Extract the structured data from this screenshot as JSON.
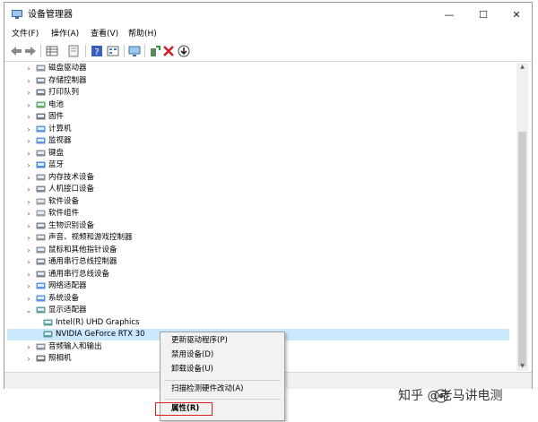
{
  "window": {
    "title": "设备管理器"
  },
  "window_controls": {
    "minimize": "—",
    "maximize": "☐",
    "close": "✕"
  },
  "menu": [
    {
      "label": "文件(F)"
    },
    {
      "label": "操作(A)"
    },
    {
      "label": "查看(V)"
    },
    {
      "label": "帮助(H)"
    }
  ],
  "toolbar": {
    "buttons": [
      {
        "icon": "back-arrow-icon"
      },
      {
        "icon": "forward-arrow-icon"
      },
      {
        "icon": "properties-grid-icon"
      },
      {
        "icon": "document-icon"
      },
      {
        "icon": "help-icon"
      },
      {
        "icon": "grid-view-icon"
      },
      {
        "icon": "monitor-scan-icon"
      },
      {
        "icon": "add-driver-icon"
      },
      {
        "icon": "remove-x-icon"
      },
      {
        "icon": "download-icon"
      }
    ]
  },
  "tree": {
    "categories": [
      {
        "label": "磁盘驱动器",
        "expander": "›",
        "icon": "disk-icon"
      },
      {
        "label": "存储控制器",
        "expander": "›",
        "icon": "storage-controller-icon"
      },
      {
        "label": "打印队列",
        "expander": "›",
        "icon": "printer-icon"
      },
      {
        "label": "电池",
        "expander": "›",
        "icon": "battery-icon"
      },
      {
        "label": "固件",
        "expander": "›",
        "icon": "firmware-icon"
      },
      {
        "label": "计算机",
        "expander": "›",
        "icon": "computer-icon"
      },
      {
        "label": "监视器",
        "expander": "›",
        "icon": "monitor-icon"
      },
      {
        "label": "键盘",
        "expander": "›",
        "icon": "keyboard-icon"
      },
      {
        "label": "蓝牙",
        "expander": "›",
        "icon": "bluetooth-icon"
      },
      {
        "label": "内存技术设备",
        "expander": "›",
        "icon": "memory-icon"
      },
      {
        "label": "人机接口设备",
        "expander": "›",
        "icon": "hid-icon"
      },
      {
        "label": "软件设备",
        "expander": "›",
        "icon": "software-device-icon"
      },
      {
        "label": "软件组件",
        "expander": "›",
        "icon": "software-component-icon"
      },
      {
        "label": "生物识别设备",
        "expander": "›",
        "icon": "biometric-icon"
      },
      {
        "label": "声音、视频和游戏控制器",
        "expander": "›",
        "icon": "sound-icon"
      },
      {
        "label": "鼠标和其他指针设备",
        "expander": "›",
        "icon": "mouse-icon"
      },
      {
        "label": "通用串行总线控制器",
        "expander": "›",
        "icon": "usb-icon"
      },
      {
        "label": "通用串行总线设备",
        "expander": "›",
        "icon": "usb-device-icon"
      },
      {
        "label": "网络适配器",
        "expander": "›",
        "icon": "network-icon"
      },
      {
        "label": "系统设备",
        "expander": "›",
        "icon": "system-device-icon"
      },
      {
        "label": "显示适配器",
        "expander": "⌄",
        "icon": "display-adapter-icon"
      }
    ],
    "display_children": [
      {
        "label": "Intel(R) UHD Graphics",
        "icon": "display-adapter-icon"
      },
      {
        "label": "NVIDIA GeForce RTX 30",
        "icon": "display-adapter-icon"
      }
    ],
    "trailing_categories": [
      {
        "label": "音频输入和输出",
        "expander": "›",
        "icon": "audio-io-icon"
      },
      {
        "label": "照相机",
        "expander": "›",
        "icon": "camera-icon"
      }
    ]
  },
  "context_menu": {
    "items": [
      {
        "label": "更新驱动程序(P)"
      },
      {
        "label": "禁用设备(D)"
      },
      {
        "label": "卸载设备(U)"
      },
      {
        "label": "扫描检测硬件改动(A)"
      },
      {
        "label": "属性(R)"
      }
    ]
  },
  "watermark": {
    "text": "知乎 @老马讲电测"
  },
  "colors": {
    "selection": "#cce8ff",
    "highlight_box": "#e02020"
  }
}
